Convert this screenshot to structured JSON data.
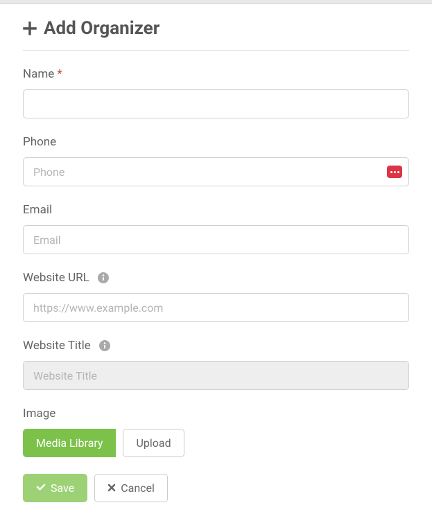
{
  "header": {
    "title": "Add Organizer"
  },
  "fields": {
    "name": {
      "label": "Name",
      "required": "*",
      "value": "",
      "placeholder": ""
    },
    "phone": {
      "label": "Phone",
      "value": "",
      "placeholder": "Phone"
    },
    "email": {
      "label": "Email",
      "value": "",
      "placeholder": "Email"
    },
    "website_url": {
      "label": "Website URL",
      "value": "",
      "placeholder": "https://www.example.com"
    },
    "website_title": {
      "label": "Website Title",
      "value": "",
      "placeholder": "Website Title"
    },
    "image": {
      "label": "Image"
    }
  },
  "buttons": {
    "media_library": "Media Library",
    "upload": "Upload",
    "save": "Save",
    "cancel": "Cancel"
  }
}
